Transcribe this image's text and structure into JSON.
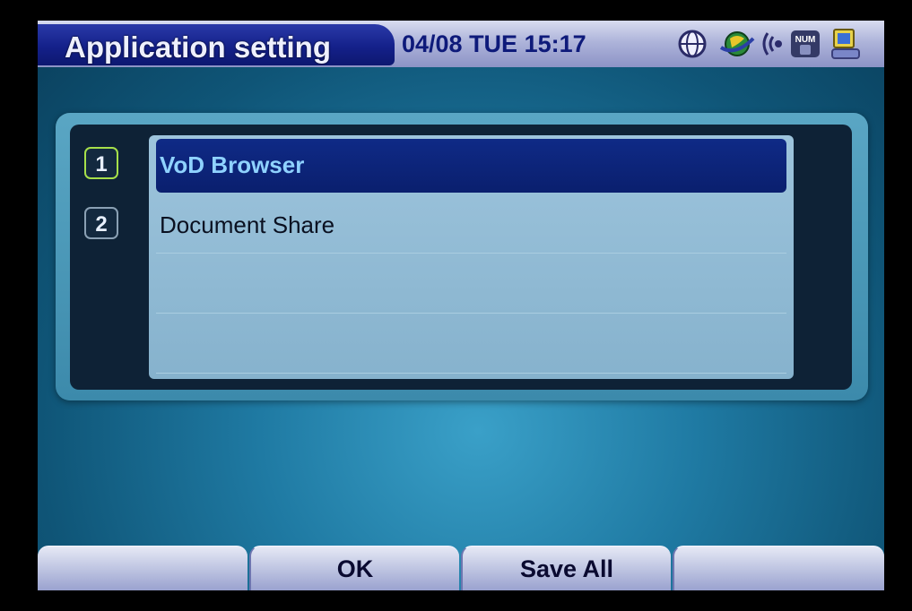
{
  "header": {
    "title": "Application setting",
    "datetime": "04/08  TUE  15:17",
    "status_icons": [
      "network-globe-icon",
      "connection-globe-icon",
      "signal-wave-icon",
      "num-lock-icon",
      "computer-icon"
    ],
    "num_icon_text": "NUM"
  },
  "list": {
    "selected_index": 0,
    "items": [
      {
        "number": "1",
        "label": "VoD Browser"
      },
      {
        "number": "2",
        "label": "Document Share"
      },
      {
        "number": "",
        "label": ""
      },
      {
        "number": "",
        "label": ""
      }
    ]
  },
  "softkeys": [
    {
      "label": ""
    },
    {
      "label": "OK"
    },
    {
      "label": "Save All"
    },
    {
      "label": ""
    }
  ],
  "colors": {
    "title_tab": "#14208a",
    "selected_row": "#0f2a86",
    "selected_text": "#8fd2ff",
    "active_number_border": "#a6e04a"
  }
}
